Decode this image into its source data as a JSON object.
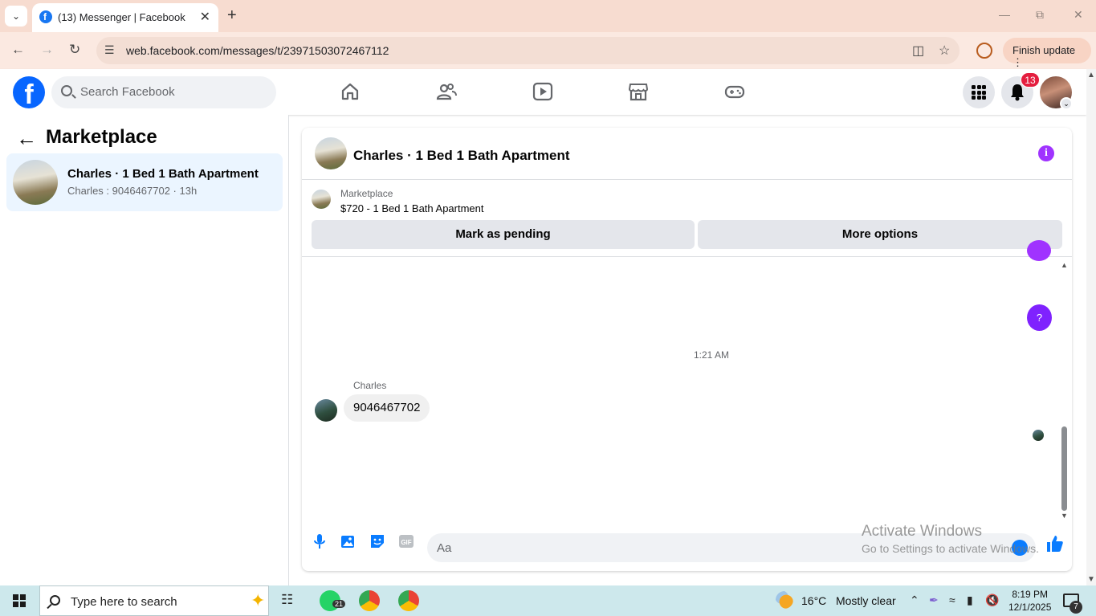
{
  "browser": {
    "tab_title": "(13) Messenger | Facebook",
    "url": "web.facebook.com/messages/t/23971503072467112",
    "finish_update": "Finish update"
  },
  "fb": {
    "search_placeholder": "Search Facebook",
    "notification_count": "13"
  },
  "sidebar": {
    "title": "Marketplace",
    "conversation": {
      "name": "Charles · 1 Bed 1 Bath Apartment",
      "preview": "Charles : 9046467702 · 13h"
    }
  },
  "chat": {
    "title": "Charles · 1 Bed 1 Bath Apartment",
    "listing_label": "Marketplace",
    "listing_price": "$720 - 1 Bed 1 Bath Apartment",
    "mark_pending": "Mark as pending",
    "more_options": "More options",
    "q_bubble": "?",
    "timestamp": "1:21 AM",
    "sender": "Charles",
    "message": "9046467702",
    "composer_placeholder": "Aa"
  },
  "watermark": {
    "line1": "Activate Windows",
    "line2": "Go to Settings to activate Windows."
  },
  "taskbar": {
    "search_placeholder": "Type here to search",
    "whatsapp_badge": "21",
    "temperature": "16°C",
    "weather": "Mostly clear",
    "time": "8:19 PM",
    "date": "12/1/2025",
    "notification_count": "7"
  },
  "colors": {
    "fb_blue": "#0866ff",
    "messenger_purple": "#a033ff",
    "selected_conversation": "#ebf5ff",
    "notification_red": "#e41e3f"
  }
}
